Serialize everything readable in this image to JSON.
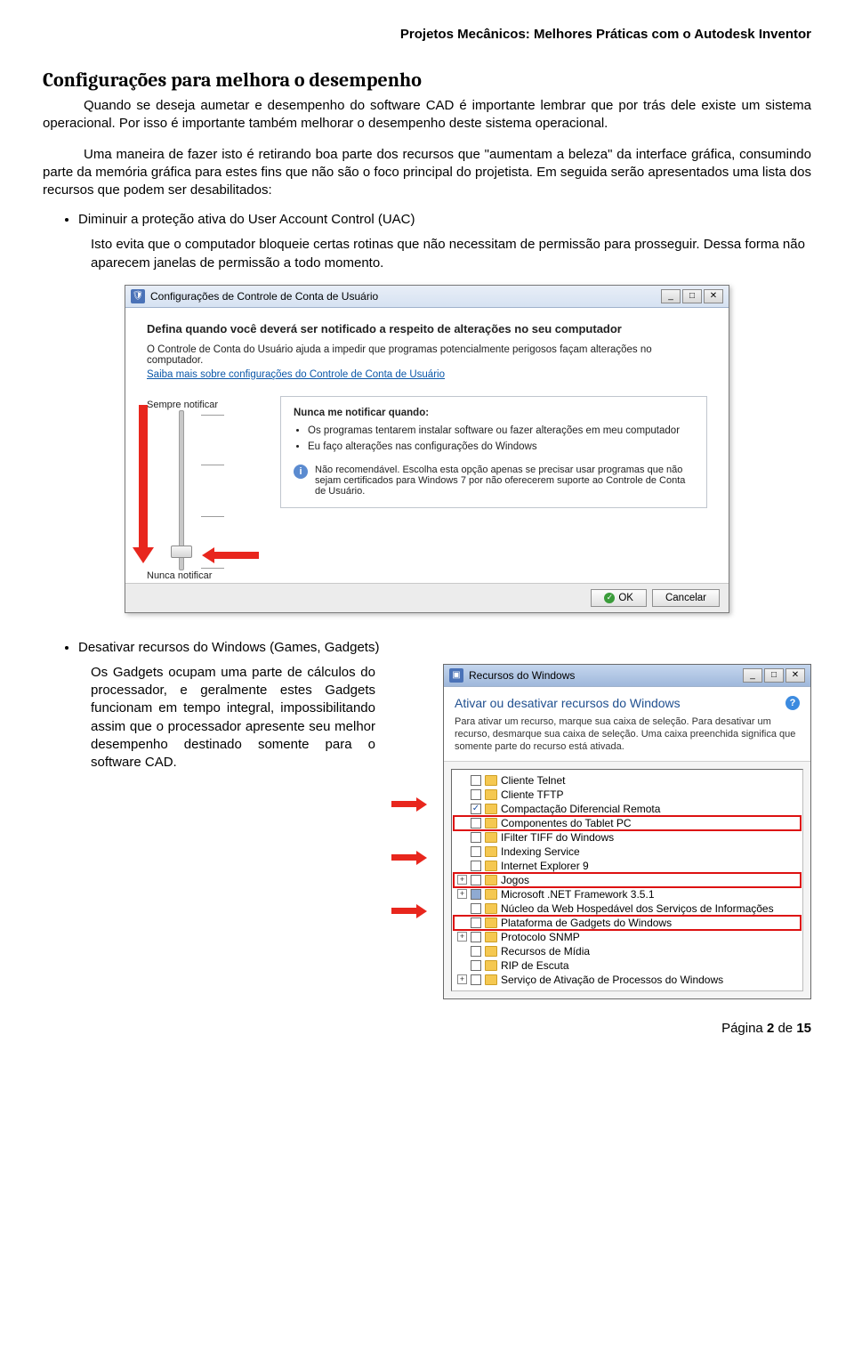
{
  "doc_header": "Projetos Mecânicos: Melhores Práticas com o Autodesk Inventor",
  "section_title": "Configurações para melhora o desempenho",
  "para1": "Quando se deseja aumetar e desempenho do software CAD é importante lembrar que por trás dele existe um sistema operacional. Por isso é importante também melhorar o desempenho deste sistema operacional.",
  "para2": "Uma maneira de fazer isto é retirando boa parte dos recursos que \"aumentam a beleza\" da interface gráfica, consumindo parte da memória gráfica para estes fins que não são o foco principal do projetista. Em seguida serão apresentados uma lista dos recursos que podem ser desabilitados:",
  "bullet1": "Diminuir a proteção ativa do User Account Control (UAC)",
  "bullet1_desc": "Isto evita que o computador bloqueie certas rotinas que não necessitam de permissão para prosseguir. Dessa forma não aparecem janelas de permissão a todo momento.",
  "uac": {
    "title": "Configurações de Controle de Conta de Usuário",
    "heading": "Defina quando você deverá ser notificado a respeito de alterações no seu computador",
    "desc": "O Controle de Conta do Usuário ajuda a impedir que programas potencialmente perigosos façam alterações no computador.",
    "link": "Saiba mais sobre configurações do Controle de Conta de Usuário",
    "top_label": "Sempre notificar",
    "bottom_label": "Nunca notificar",
    "box_title": "Nunca me notificar quando:",
    "li1": "Os programas tentarem instalar software ou fazer alterações em meu computador",
    "li2": "Eu faço alterações nas configurações do Windows",
    "warn": "Não recomendável. Escolha esta opção apenas se precisar usar programas que não sejam certificados para Windows 7 por não oferecerem suporte ao Controle de Conta de Usuário.",
    "ok": "OK",
    "cancel": "Cancelar"
  },
  "bullet2": "Desativar recursos do Windows (Games, Gadgets)",
  "bullet2_desc": "Os Gadgets ocupam uma parte de cálculos do processador, e geralmente estes Gadgets funcionam em tempo integral, impossibilitando assim que o processador apresente seu melhor desempenho destinado somente para o software CAD.",
  "features": {
    "title": "Recursos do Windows",
    "heading": "Ativar ou desativar recursos do Windows",
    "desc": "Para ativar um recurso, marque sua caixa de seleção. Para desativar um recurso, desmarque sua caixa de seleção. Uma caixa preenchida significa que somente parte do recurso está ativada.",
    "items": [
      {
        "exp": "",
        "chk": "",
        "label": "Cliente Telnet",
        "hl": false
      },
      {
        "exp": "",
        "chk": "",
        "label": "Cliente TFTP",
        "hl": false
      },
      {
        "exp": "",
        "chk": "checked",
        "label": "Compactação Diferencial Remota",
        "hl": false
      },
      {
        "exp": "",
        "chk": "",
        "label": "Componentes do Tablet PC",
        "hl": true
      },
      {
        "exp": "",
        "chk": "",
        "label": "IFilter TIFF do Windows",
        "hl": false
      },
      {
        "exp": "",
        "chk": "",
        "label": "Indexing Service",
        "hl": false
      },
      {
        "exp": "",
        "chk": "",
        "label": "Internet Explorer 9",
        "hl": false
      },
      {
        "exp": "+",
        "chk": "",
        "label": "Jogos",
        "hl": true
      },
      {
        "exp": "+",
        "chk": "filled",
        "label": "Microsoft .NET Framework 3.5.1",
        "hl": false
      },
      {
        "exp": "",
        "chk": "",
        "label": "Núcleo da Web Hospedável dos Serviços de Informações",
        "hl": false
      },
      {
        "exp": "",
        "chk": "",
        "label": "Plataforma de Gadgets do Windows",
        "hl": true
      },
      {
        "exp": "+",
        "chk": "",
        "label": "Protocolo SNMP",
        "hl": false
      },
      {
        "exp": "",
        "chk": "",
        "label": "Recursos de Mídia",
        "hl": false
      },
      {
        "exp": "",
        "chk": "",
        "label": "RIP de Escuta",
        "hl": false
      },
      {
        "exp": "+",
        "chk": "",
        "label": "Serviço de Ativação de Processos do Windows",
        "hl": false
      }
    ]
  },
  "footer_prefix": "Página ",
  "footer_page": "2",
  "footer_mid": " de ",
  "footer_total": "15"
}
